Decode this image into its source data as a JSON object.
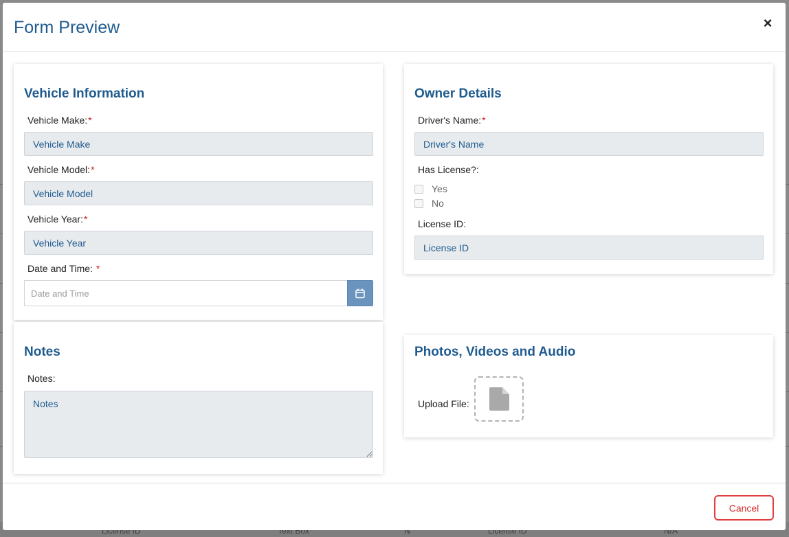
{
  "modal": {
    "title": "Form Preview",
    "close_glyph": "×",
    "cancel_label": "Cancel"
  },
  "vehicle": {
    "title": "Vehicle Information",
    "make_label": "Vehicle Make:",
    "make_placeholder": "Vehicle Make",
    "model_label": "Vehicle Model:",
    "model_placeholder": "Vehicle Model",
    "year_label": "Vehicle Year:",
    "year_placeholder": "Vehicle Year",
    "datetime_label": "Date and Time:",
    "datetime_placeholder": "Date and Time",
    "required_mark": "*"
  },
  "owner": {
    "title": "Owner Details",
    "driver_label": "Driver's Name:",
    "driver_placeholder": "Driver's Name",
    "has_license_label": "Has License?:",
    "option_yes": "Yes",
    "option_no": "No",
    "license_label": "License ID:",
    "license_placeholder": "License ID"
  },
  "notes": {
    "title": "Notes",
    "label": "Notes:",
    "placeholder": "Notes"
  },
  "media": {
    "title": "Photos, Videos and Audio",
    "upload_label": "Upload File:"
  },
  "background_table": {
    "cells": [
      "License ID",
      "Text Box",
      "N",
      "License ID",
      "N/A"
    ]
  },
  "colors": {
    "accent": "#1f5b8f",
    "required": "#d0161c",
    "cancel": "#e23c3c",
    "calendar_button": "#6a93bd"
  }
}
